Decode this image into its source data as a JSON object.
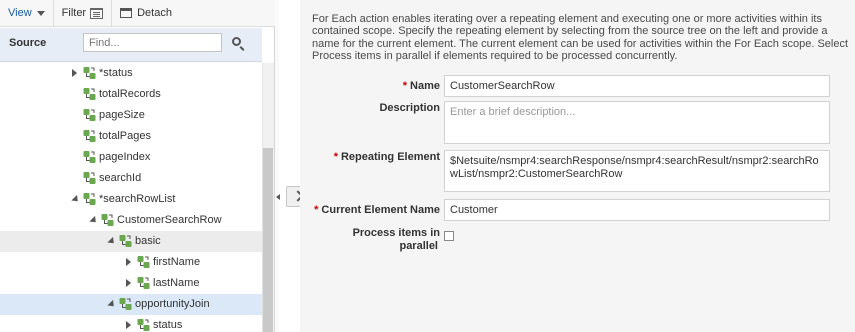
{
  "toolbar": {
    "view_label": "View",
    "filter_label": "Filter",
    "detach_label": "Detach"
  },
  "source": {
    "label": "Source",
    "search_placeholder": "Find..."
  },
  "tree": {
    "nodes": [
      {
        "label": "*status",
        "depth": 0,
        "toggle": "collapsed",
        "state": ""
      },
      {
        "label": "totalRecords",
        "depth": 0,
        "toggle": "none",
        "state": ""
      },
      {
        "label": "pageSize",
        "depth": 0,
        "toggle": "none",
        "state": ""
      },
      {
        "label": "totalPages",
        "depth": 0,
        "toggle": "none",
        "state": ""
      },
      {
        "label": "pageIndex",
        "depth": 0,
        "toggle": "none",
        "state": ""
      },
      {
        "label": "searchId",
        "depth": 0,
        "toggle": "none",
        "state": ""
      },
      {
        "label": "*searchRowList",
        "depth": 0,
        "toggle": "expanded",
        "state": ""
      },
      {
        "label": "CustomerSearchRow",
        "depth": 1,
        "toggle": "expanded",
        "state": ""
      },
      {
        "label": "basic",
        "depth": 2,
        "toggle": "expanded",
        "state": "gray"
      },
      {
        "label": "firstName",
        "depth": 3,
        "toggle": "collapsed",
        "state": ""
      },
      {
        "label": "lastName",
        "depth": 3,
        "toggle": "collapsed",
        "state": ""
      },
      {
        "label": "opportunityJoin",
        "depth": 2,
        "toggle": "expanded",
        "state": "blue"
      },
      {
        "label": "status",
        "depth": 3,
        "toggle": "collapsed",
        "state": ""
      }
    ]
  },
  "description": "For Each action enables iterating over a repeating element and executing one or more activities within its contained scope. Specify the repeating element by selecting from the source tree on the left and provide a name for the current element. The current element can be used for activities within the For Each scope. Select Process items in parallel if elements required to be processed concurrently.",
  "form": {
    "name_label": "Name",
    "name_value": "CustomerSearchRow",
    "description_label": "Description",
    "description_placeholder": "Enter a brief description...",
    "repeating_label": "Repeating Element",
    "repeating_value": "$Netsuite/nsmpr4:searchResponse/nsmpr4:searchResult/nsmpr2:searchRowList/nsmpr2:CustomerSearchRow",
    "current_label": "Current Element Name",
    "current_value": "Customer",
    "parallel_label_line1": "Process items in",
    "parallel_label_line2": "parallel",
    "parallel_checked": false
  },
  "colors": {
    "icon_green": "#6aa84f",
    "selected_row": "#dbe8f7",
    "highlight_row": "#ececec"
  }
}
